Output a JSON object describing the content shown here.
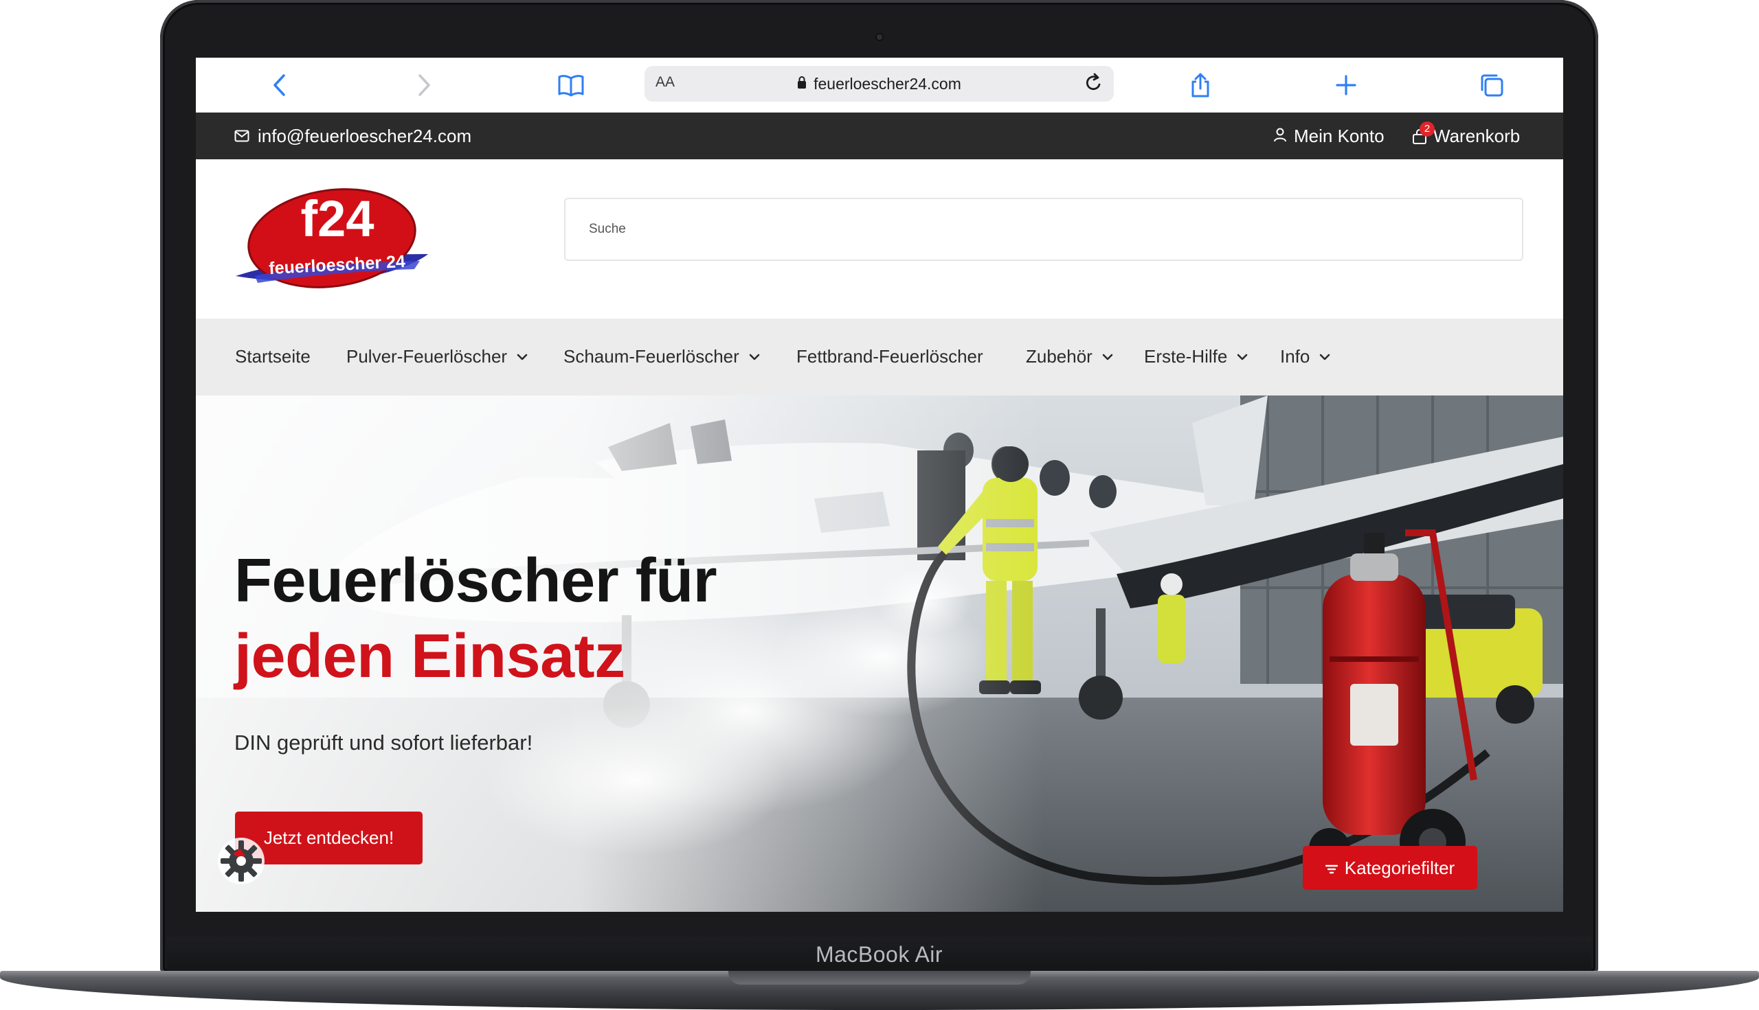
{
  "device": {
    "label": "MacBook Air"
  },
  "browser": {
    "url": "feuerloescher24.com",
    "reader_label": "AA",
    "icons": [
      "back-icon",
      "forward-icon",
      "bookmarks-icon",
      "lock-icon",
      "reload-icon",
      "share-icon",
      "new-tab-icon",
      "tabs-icon"
    ]
  },
  "topbar": {
    "email": "info@feuerloescher24.com",
    "account_label": "Mein Konto",
    "cart_label": "Warenkorb",
    "cart_count": "2"
  },
  "header": {
    "logo_main": "f24",
    "logo_sub": "feuerloescher 24",
    "search_placeholder": "Suche"
  },
  "nav": {
    "items": [
      {
        "label": "Startseite",
        "has_dropdown": false
      },
      {
        "label": "Pulver-Feuerlöscher",
        "has_dropdown": true
      },
      {
        "label": "Schaum-Feuerlöscher",
        "has_dropdown": true
      },
      {
        "label": "Fettbrand-Feuerlöscher",
        "has_dropdown": false
      },
      {
        "label": "Zubehör",
        "has_dropdown": true
      },
      {
        "label": "Erste-Hilfe",
        "has_dropdown": true
      },
      {
        "label": "Info",
        "has_dropdown": true
      }
    ]
  },
  "hero": {
    "title_line1": "Feuerlöscher für",
    "title_line2": "jeden Einsatz",
    "subtitle": "DIN geprüft und sofort lieferbar!",
    "cta_label": "Jetzt entdecken!",
    "filter_label": "Kategoriefilter"
  },
  "colors": {
    "brand_red": "#d0121b",
    "topbar_bg": "#2b2b2b",
    "nav_bg": "#ececec",
    "safari_blue": "#2f7ff5"
  }
}
